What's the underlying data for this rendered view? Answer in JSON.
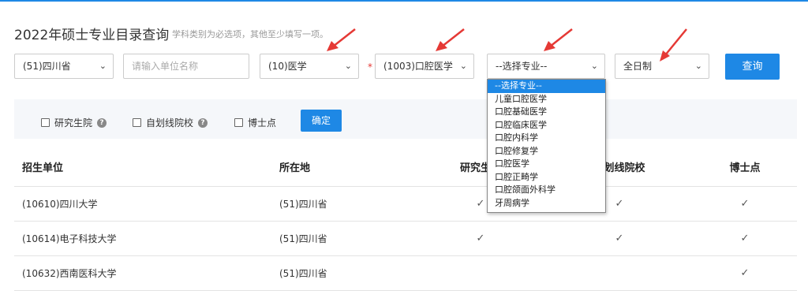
{
  "page": {
    "title": "2022年硕士专业目录查询",
    "subtitle": "学科类别为必选项，其他至少填写一项。"
  },
  "filters": {
    "province": "(51)四川省",
    "unit_placeholder": "请输入单位名称",
    "discipline": "(10)医学",
    "required_mark": "*",
    "field": "(1003)口腔医学",
    "major": "--选择专业--",
    "study_mode": "全日制",
    "query_button": "查询"
  },
  "options": {
    "graduate_school": "研究生院",
    "self_line": "自划线院校",
    "doctoral": "博士点",
    "confirm_button": "确定"
  },
  "table": {
    "headers": [
      "招生单位",
      "所在地",
      "研究生院",
      "自划线院校",
      "博士点"
    ],
    "rows": [
      {
        "unit": "(10610)四川大学",
        "location": "(51)四川省",
        "grad": "✓",
        "self": "✓",
        "phd": "✓"
      },
      {
        "unit": "(10614)电子科技大学",
        "location": "(51)四川省",
        "grad": "✓",
        "self": "✓",
        "phd": "✓"
      },
      {
        "unit": "(10632)西南医科大学",
        "location": "(51)四川省",
        "grad": "",
        "self": "",
        "phd": "✓"
      }
    ]
  },
  "major_dropdown": {
    "options": [
      "--选择专业--",
      "儿童口腔医学",
      "口腔基础医学",
      "口腔临床医学",
      "口腔内科学",
      "口腔修复学",
      "口腔医学",
      "口腔正畸学",
      "口腔颌面外科学",
      "牙周病学"
    ],
    "selected_index": 0
  },
  "colors": {
    "accent": "#1e88e5",
    "annotation_arrow": "#e53935"
  }
}
